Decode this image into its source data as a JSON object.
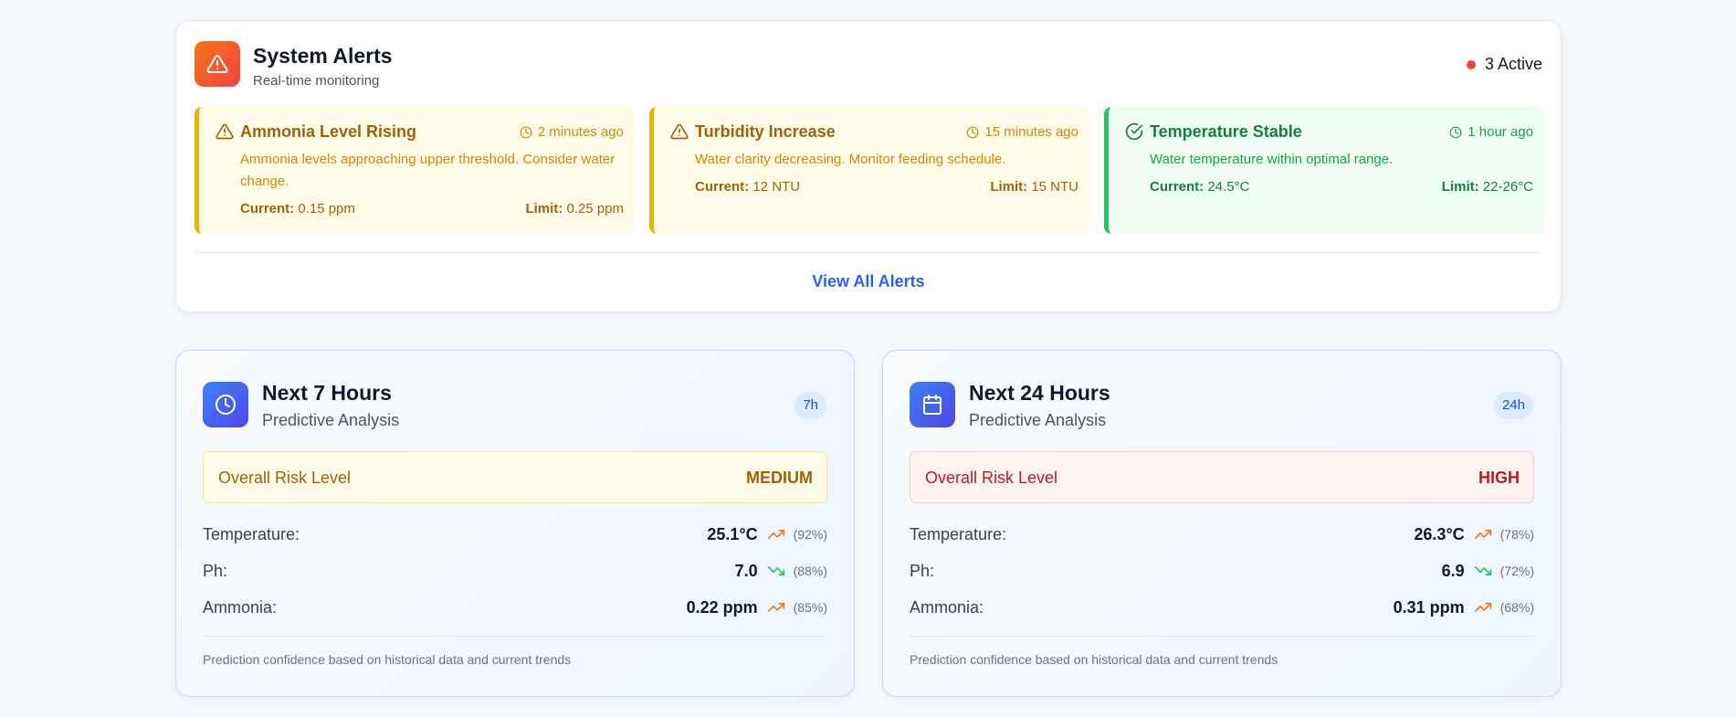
{
  "alerts_panel": {
    "title": "System Alerts",
    "subtitle": "Real-time monitoring",
    "active_count": "3 Active",
    "view_all": "View All Alerts",
    "alerts": [
      {
        "title": "Ammonia Level Rising",
        "time": "2 minutes ago",
        "message": "Ammonia levels approaching upper threshold. Consider water change.",
        "current_label": "Current:",
        "current_value": "0.15 ppm",
        "limit_label": "Limit:",
        "limit_value": "0.25 ppm",
        "severity": "warning",
        "icon": "warning-triangle-icon"
      },
      {
        "title": "Turbidity Increase",
        "time": "15 minutes ago",
        "message": "Water clarity decreasing. Monitor feeding schedule.",
        "current_label": "Current:",
        "current_value": "12 NTU",
        "limit_label": "Limit:",
        "limit_value": "15 NTU",
        "severity": "warning",
        "icon": "warning-triangle-icon"
      },
      {
        "title": "Temperature Stable",
        "time": "1 hour ago",
        "message": "Water temperature within optimal range.",
        "current_label": "Current:",
        "current_value": "24.5°C",
        "limit_label": "Limit:",
        "limit_value": "22-26°C",
        "severity": "ok",
        "icon": "check-circle-icon"
      }
    ]
  },
  "predictions": [
    {
      "title": "Next 7 Hours",
      "subtitle": "Predictive Analysis",
      "badge": "7h",
      "icon": "clock-icon",
      "risk_label": "Overall Risk Level",
      "risk_value": "MEDIUM",
      "metrics": [
        {
          "label": "Temperature:",
          "value": "25.1°C",
          "trend": "up",
          "confidence": "(92%)"
        },
        {
          "label": "Ph:",
          "value": "7.0",
          "trend": "down",
          "confidence": "(88%)"
        },
        {
          "label": "Ammonia:",
          "value": "0.22 ppm",
          "trend": "up",
          "confidence": "(85%)"
        }
      ],
      "footer": "Prediction confidence based on historical data and current trends"
    },
    {
      "title": "Next 24 Hours",
      "subtitle": "Predictive Analysis",
      "badge": "24h",
      "icon": "calendar-icon",
      "risk_label": "Overall Risk Level",
      "risk_value": "HIGH",
      "metrics": [
        {
          "label": "Temperature:",
          "value": "26.3°C",
          "trend": "up",
          "confidence": "(78%)"
        },
        {
          "label": "Ph:",
          "value": "6.9",
          "trend": "down",
          "confidence": "(72%)"
        },
        {
          "label": "Ammonia:",
          "value": "0.31 ppm",
          "trend": "up",
          "confidence": "(68%)"
        }
      ],
      "footer": "Prediction confidence based on historical data and current trends"
    }
  ],
  "colors": {
    "warning": "#ca8a04",
    "ok": "#16a34a",
    "danger": "#ef4444",
    "link": "#2563eb",
    "trend_up": "#f97316",
    "trend_down": "#22c55e"
  }
}
